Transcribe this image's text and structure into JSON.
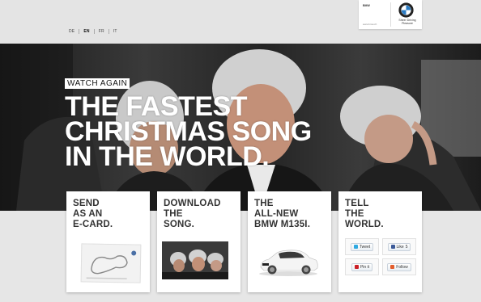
{
  "header": {
    "languages": [
      {
        "code": "DE",
        "active": false
      },
      {
        "code": "EN",
        "active": true
      },
      {
        "code": "FR",
        "active": false
      },
      {
        "code": "IT",
        "active": false
      }
    ],
    "logo": {
      "brand_small": "BMW",
      "url": "www.bmw.ch",
      "tagline": "Sheer Driving Pleasure",
      "roundel_icon": "bmw-roundel-icon"
    }
  },
  "hero": {
    "watch_again_label": "WATCH AGAIN",
    "headline_lines": [
      "THE FASTEST",
      "CHRISTMAS SONG",
      "IN THE WORLD."
    ]
  },
  "cards": [
    {
      "title_lines": [
        "SEND",
        "AS AN",
        "E-CARD."
      ],
      "thumb_icon": "race-track-card-icon"
    },
    {
      "title_lines": [
        "DOWNLOAD",
        "THE",
        "SONG."
      ],
      "thumb_icon": "video-still-icon"
    },
    {
      "title_lines": [
        "THE",
        "ALL-NEW",
        "BMW M135i."
      ],
      "thumb_icon": "white-car-icon"
    },
    {
      "title_lines": [
        "TELL",
        "THE",
        "WORLD."
      ]
    }
  ],
  "social": [
    {
      "label": "Tweet",
      "icon": "twitter-icon",
      "color": "#2fa9e1"
    },
    {
      "label": "Like",
      "count": "5",
      "icon": "facebook-like-icon",
      "color": "#3b5998"
    },
    {
      "label": "Pin it",
      "icon": "pinterest-icon",
      "color": "#cb2027"
    },
    {
      "label": "Follow",
      "icon": "tumblr-follow-icon",
      "color": "#e35d2c"
    }
  ],
  "colors": {
    "page_bg": "#e6e6e6",
    "card_title": "#333333",
    "headline": "#ffffff"
  }
}
